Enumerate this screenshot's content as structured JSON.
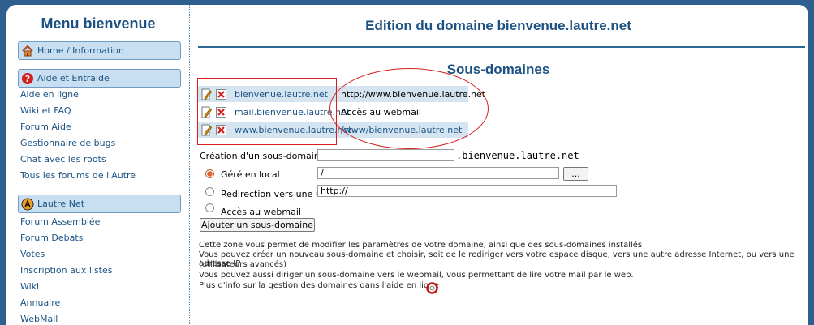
{
  "sidebar": {
    "title": "Menu bienvenue",
    "sections": [
      {
        "label": "Home / Information",
        "icon": "house-icon"
      },
      {
        "label": "Aide et Entraide",
        "icon": "help-icon"
      },
      {
        "label": "Lautre Net",
        "icon": "lautre-logo-icon"
      }
    ],
    "aide_links": [
      "Aide en ligne",
      "Wiki et FAQ",
      "Forum Aide",
      "Gestionnaire de bugs",
      "Chat avec les roots",
      "Tous les forums de l'Autre"
    ],
    "lautre_links": [
      "Forum Assemblée",
      "Forum Debats",
      "Votes",
      "Inscription aux listes",
      "Wiki",
      "Annuaire",
      "WebMail"
    ]
  },
  "main": {
    "title": "Edition du domaine bienvenue.lautre.net",
    "subtitle": "Sous-domaines",
    "subdomains": [
      {
        "name": "bienvenue.lautre.net",
        "target": "http://www.bienvenue.lautre.net"
      },
      {
        "name": "mail.bienvenue.lautre.net",
        "target": "Accès au webmail"
      },
      {
        "name": "www.bienvenue.lautre.net",
        "target": "/www/bienvenue.lautre.net"
      }
    ],
    "form": {
      "create_label": "Création d'un sous-domaine :",
      "create_value": "",
      "domain_suffix": ".bienvenue.lautre.net",
      "local_label": "Géré en local",
      "local_value": "/",
      "browse_label": "...",
      "redirect_label": "Redirection vers une url",
      "redirect_value": "http://",
      "webmail_label": "Accès au webmail",
      "submit_label": "Ajouter un sous-domaine"
    },
    "help": [
      "Cette zone vous permet de modifier les paramètres de votre domaine, ainsi que des sous-domaines installés",
      "Vous pouvez créer un nouveau sous-domaine et choisir, soit de le rediriger vers votre espace disque, vers une autre adresse Internet, ou vers une adresse IP",
      "(utilisateurs avancés)",
      "Vous pouvez aussi diriger un sous-domaine vers le webmail, vous permettant de lire votre mail par le web.",
      "Plus d'info sur la gestion des domaines dans l'aide en ligne"
    ]
  }
}
